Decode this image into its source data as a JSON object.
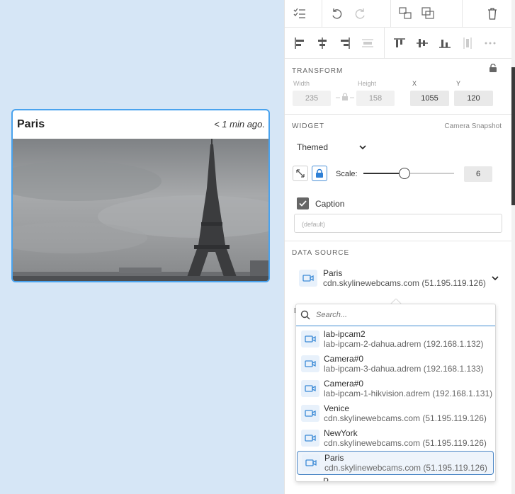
{
  "widget": {
    "title": "Paris",
    "updated": "< 1 min ago."
  },
  "transform": {
    "label": "TRANSFORM",
    "width_label": "Width",
    "height_label": "Height",
    "x_label": "X",
    "y_label": "Y",
    "width": "235",
    "height": "158",
    "x": "1055",
    "y": "120"
  },
  "widget_section": {
    "label": "WIDGET",
    "type": "Camera Snapshot",
    "theme": "Themed",
    "scale_label": "Scale:",
    "scale": "6",
    "scale_level": 0.45,
    "caption_label": "Caption",
    "caption_placeholder": "(default)"
  },
  "data_source": {
    "label": "DATA SOURCE",
    "selected_name": "Paris",
    "selected_host": "cdn.skylinewebcams.com (51.195.119.126)",
    "hidden_label_initial": "D"
  },
  "dropdown": {
    "search_placeholder": "Search...",
    "options": [
      {
        "name": "lab-ipcam2",
        "host": "lab-ipcam-2-dahua.adrem (192.168.1.132)"
      },
      {
        "name": "Camera#0",
        "host": "lab-ipcam-3-dahua.adrem (192.168.1.133)"
      },
      {
        "name": "Camera#0",
        "host": "lab-ipcam-1-hikvision.adrem (192.168.1.131)"
      },
      {
        "name": "Venice",
        "host": "cdn.skylinewebcams.com (51.195.119.126)"
      },
      {
        "name": "NewYork",
        "host": "cdn.skylinewebcams.com (51.195.119.126)"
      },
      {
        "name": "Paris",
        "host": "cdn.skylinewebcams.com (51.195.119.126)"
      }
    ],
    "partial_next": "P"
  },
  "icons": {
    "checklist": "checklist-icon",
    "undo": "undo-icon",
    "redo": "redo-icon",
    "group": "group-icon",
    "ungroup": "ungroup-icon",
    "delete": "trash-icon",
    "camera": "video-camera-icon",
    "lock": "lock-icon"
  },
  "colors": {
    "accent": "#4aa3ee",
    "canvas": "#d6e6f6",
    "selected_border": "#4b86c5"
  }
}
